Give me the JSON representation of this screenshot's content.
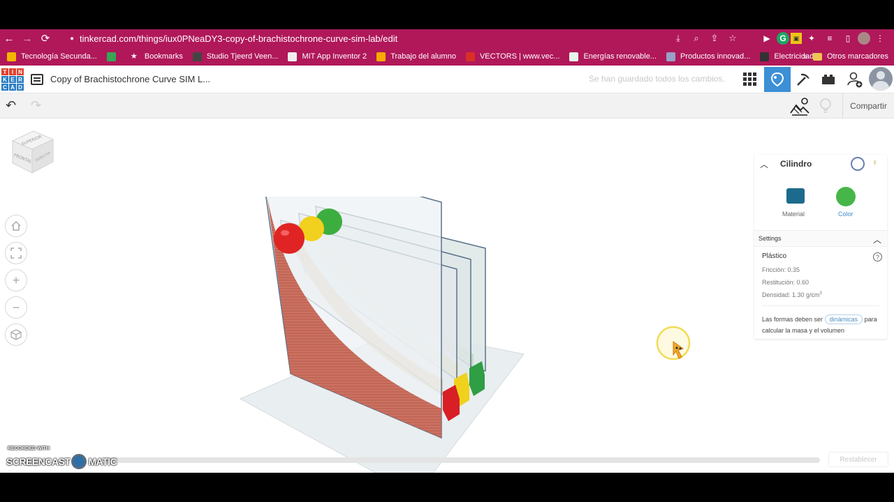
{
  "browser": {
    "url": "tinkercad.com/things/iux0PNeaDY3-copy-of-brachistochrone-curve-sim-lab/edit"
  },
  "bookmarks": {
    "items": [
      {
        "label": "Tecnología Secunda...",
        "color": "#f4b400"
      },
      {
        "label": "",
        "color": "#34a853"
      },
      {
        "label": "Bookmarks",
        "icon": "star-icon"
      },
      {
        "label": "Studio Tjeerd Veen...",
        "color": "#444444"
      },
      {
        "label": "MIT App Inventor 2",
        "color": "#eeeeee"
      },
      {
        "label": "Trabajo del alumno",
        "color": "#f9ab00"
      },
      {
        "label": "VECTORS | www.vec...",
        "color": "#d93025"
      },
      {
        "label": "Energías renovable...",
        "color": "#e6f4ea"
      },
      {
        "label": "Productos innovad...",
        "color": "#9aa0c6"
      },
      {
        "label": "Electricidad",
        "color": "#333333"
      }
    ],
    "more": "»",
    "other": "Otros marcadores"
  },
  "app": {
    "logo_letters": [
      "T",
      "I",
      "N",
      "K",
      "E",
      "R",
      "C",
      "A",
      "D"
    ],
    "logo_colors": [
      "#e2402f",
      "#e2402f",
      "#e2402f",
      "#2b7ec4",
      "#2b7ec4",
      "#2b7ec4",
      "#2b7ec4",
      "#2b7ec4",
      "#2b7ec4"
    ],
    "title": "Copy of Brachistochrone Curve SIM L...",
    "saved_status": "Se han guardado todos los cambios.",
    "share_label": "Compartir"
  },
  "view_cube": {
    "top_label": "SUPERIOR",
    "front_label": "FRONTAL",
    "side_label": "DERECHA"
  },
  "panel": {
    "title": "Cilindro",
    "material_label": "Material",
    "color_label": "Color",
    "material_color": "#1d6b8c",
    "color_value": "#46b649",
    "settings_label": "Settings",
    "material_name": "Plástico",
    "friction": "Fricción: 0.35",
    "restitution": "Restitución: 0.60",
    "density": "Densidad: 1.30 g/cm",
    "density_sup": "3",
    "note_before": "Las formas deben ser",
    "note_pill": "dinámicas",
    "note_after": "para calcular la masa y el volumen"
  },
  "bottom": {
    "reset_label": "Restablecer"
  },
  "watermark": {
    "top": "RECORDED WITH",
    "left": "SCREENCAST",
    "right": "MATIC"
  },
  "scene": {
    "ball_colors": [
      "#e02424",
      "#f2d01e",
      "#3cae3f"
    ],
    "block_colors": [
      "#d81f26",
      "#f0d21c",
      "#2f9e44"
    ]
  }
}
